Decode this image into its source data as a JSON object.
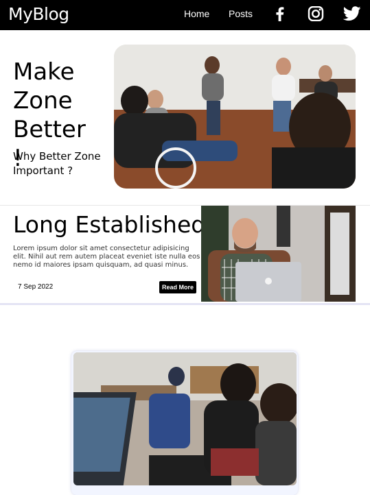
{
  "navbar": {
    "logo": "MyBlog",
    "links": [
      {
        "label": "Home"
      },
      {
        "label": "Posts"
      }
    ],
    "social": [
      "facebook-icon",
      "instagram-icon",
      "twitter-icon"
    ]
  },
  "hero": {
    "title": "Make Zone Better !",
    "subtitle": "Why Better Zone Important ?"
  },
  "post": {
    "title": "Long Established",
    "excerpt": "Lorem ipsum dolor sit amet consectetur adipisicing elit. Nihil aut rem autem placeat eveniet iste nulla eos nemo id maiores ipsam quisquam, ad quasi minus.",
    "date": "7 Sep 2022",
    "read_more": "Read More"
  },
  "colors": {
    "navbar_bg": "#000000",
    "button_bg": "#000000",
    "card_bg": "#f2f5ff"
  }
}
